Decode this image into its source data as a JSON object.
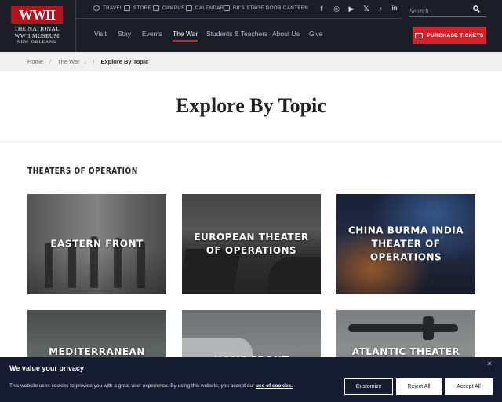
{
  "logo": {
    "mark": "WWII",
    "line1": "The National",
    "line2": "WWII Museum",
    "line3": "New Orleans"
  },
  "utility_nav": [
    {
      "label": "Travel",
      "icon": "map-pin-icon"
    },
    {
      "label": "Store",
      "icon": "store-icon"
    },
    {
      "label": "Campus",
      "icon": "campus-icon"
    },
    {
      "label": "Calendar",
      "icon": "calendar-icon"
    },
    {
      "label": "BB's Stage Door Canteen",
      "icon": "canteen-icon"
    }
  ],
  "social": [
    {
      "name": "facebook-icon",
      "glyph": "f"
    },
    {
      "name": "instagram-icon",
      "glyph": "◎"
    },
    {
      "name": "youtube-icon",
      "glyph": "▶"
    },
    {
      "name": "x-icon",
      "glyph": "𝕏"
    },
    {
      "name": "tiktok-icon",
      "glyph": "♪"
    },
    {
      "name": "linkedin-icon",
      "glyph": "in"
    }
  ],
  "search": {
    "placeholder": "Search"
  },
  "main_nav": [
    {
      "label": "Visit"
    },
    {
      "label": "Stay"
    },
    {
      "label": "Events"
    },
    {
      "label": "The War",
      "active": true
    },
    {
      "label": "Students & Teachers"
    },
    {
      "label": "About Us"
    },
    {
      "label": "Give"
    }
  ],
  "cta": {
    "label": "Purchase Tickets"
  },
  "breadcrumb": {
    "home": "Home",
    "section": "The War",
    "section_icon": "↓",
    "current": "Explore By Topic"
  },
  "page": {
    "title": "Explore By Topic",
    "section_title": "Theaters of Operation"
  },
  "cards": [
    {
      "label": "Eastern Front"
    },
    {
      "label": "European Theater of Operations"
    },
    {
      "label": "China Burma India Theater of Operations"
    },
    {
      "label": "Mediterranean Theater of"
    },
    {
      "label": "Home Front"
    },
    {
      "label": "Atlantic Theater of"
    }
  ],
  "cookie": {
    "title": "We value your privacy",
    "text": "This website uses cookies to provide you with a great user experience. By using this website, you accept our",
    "link": "use of cookies.",
    "close": "×",
    "customize": "Customize",
    "reject": "Reject All",
    "accept": "Accept All"
  },
  "colors": {
    "header_bg": "#1b1e26",
    "brand_red": "#d2232a",
    "cookie_bg": "#151b31"
  }
}
